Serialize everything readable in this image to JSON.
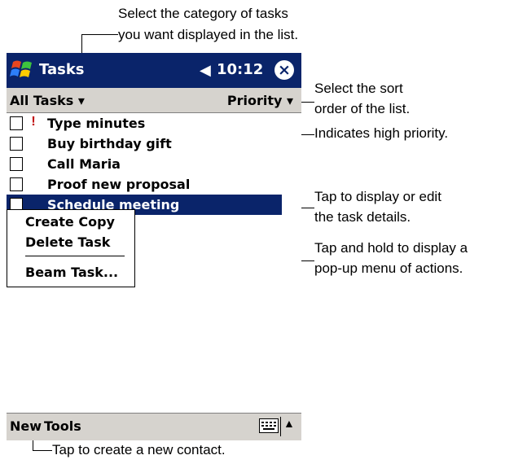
{
  "annotations": {
    "category_line1": "Select the category of tasks",
    "category_line2": "you want displayed in the list.",
    "sort_line1": "Select the sort",
    "sort_line2": "order of the list.",
    "priority": "Indicates high priority.",
    "details_line1": "Tap to display or edit",
    "details_line2": "the task details.",
    "popup_line1": "Tap and hold to display a",
    "popup_line2": "pop-up menu of actions.",
    "new_contact": "Tap to create a new contact."
  },
  "titlebar": {
    "app_title": "Tasks",
    "speaker_icon": "≤€",
    "time": "10:12",
    "close_icon": "×",
    "background": "#0a246a"
  },
  "filterbar": {
    "category": "All Tasks",
    "sort": "Priority"
  },
  "tasks": [
    {
      "text": "Type minutes",
      "priority_mark": "!",
      "high_priority": true,
      "selected": false
    },
    {
      "text": "Buy birthday  gift",
      "priority_mark": "",
      "high_priority": false,
      "selected": false
    },
    {
      "text": "Call Maria",
      "priority_mark": "",
      "high_priority": false,
      "selected": false
    },
    {
      "text": "Proof new proposal",
      "priority_mark": "",
      "high_priority": false,
      "selected": false
    },
    {
      "text": "Schedule meeting",
      "priority_mark": "",
      "high_priority": false,
      "selected": true
    }
  ],
  "popup_menu": {
    "items": [
      "Create Copy",
      "Delete Task",
      "Beam Task..."
    ]
  },
  "bottombar": {
    "menus": [
      "New",
      "Tools"
    ],
    "icons": [
      "keyboard-icon",
      "arrow-up-icon"
    ]
  }
}
